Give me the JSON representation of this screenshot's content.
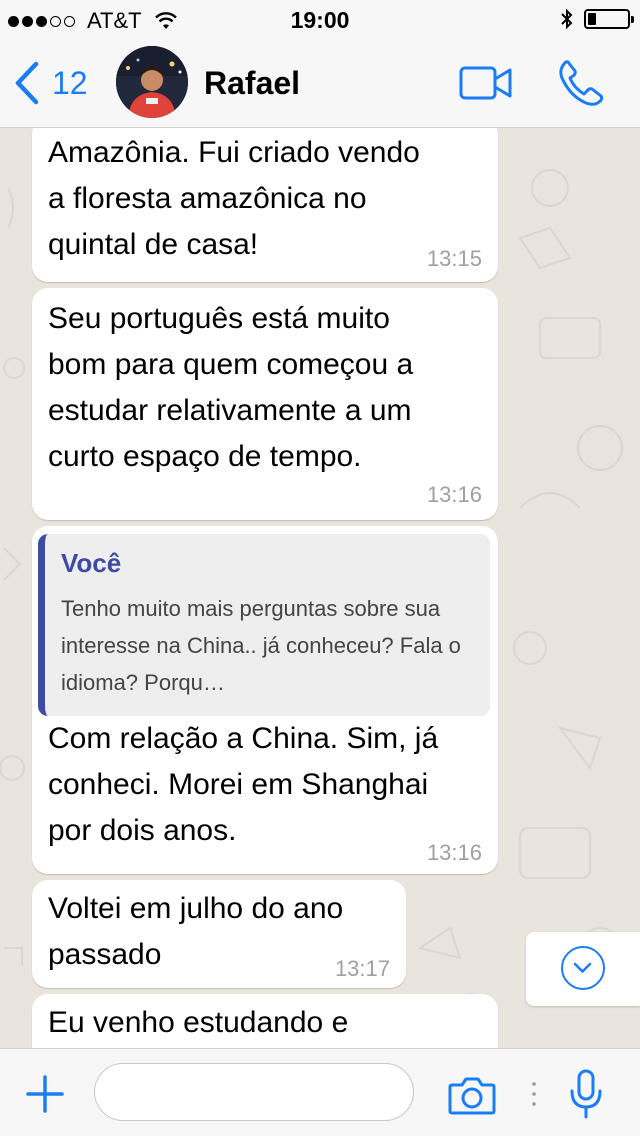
{
  "status_bar": {
    "carrier": "AT&T",
    "time": "19:00",
    "signal_bars_filled": 3,
    "signal_bars_total": 5,
    "battery_level": 0.22
  },
  "header": {
    "back_count": "12",
    "contact_name": "Rafael"
  },
  "messages": [
    {
      "text": "Amazônia. Fui criado vendo\na floresta amazônica no\nquintal de casa!",
      "time": "13:15"
    },
    {
      "text": "Seu português está muito\nbom para quem começou a\nestudar relativamente a um\ncurto espaço de tempo.",
      "time": "13:16"
    },
    {
      "quote_author": "Você",
      "quote_text": "Tenho muito mais perguntas sobre sua interesse na China.. já conheceu? Fala o idioma? Porqu…",
      "text": "Com relação a China. Sim, já\nconheci. Morei em Shanghai\npor dois anos.",
      "time": "13:16"
    },
    {
      "text": "Voltei em julho do ano\npassado",
      "time": "13:17"
    },
    {
      "text": "Eu venho estudando e"
    }
  ],
  "input": {
    "placeholder": ""
  },
  "colors": {
    "accent": "#1a7df6",
    "quote_bar": "#3f4aa3",
    "chat_background": "#e9e4dc",
    "bubble": "#ffffff",
    "timestamp": "#a0a0a0"
  },
  "icons": {
    "back": "chevron-left-icon",
    "video": "video-camera-icon",
    "call": "phone-icon",
    "scroll": "chevron-down-circle-icon",
    "attach": "plus-icon",
    "camera": "camera-icon",
    "mic": "microphone-icon"
  }
}
